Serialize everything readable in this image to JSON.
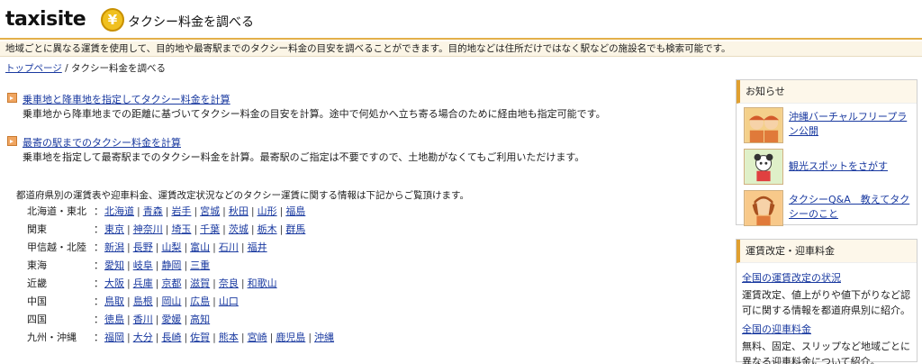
{
  "header": {
    "logo_text": "taxisite",
    "logo_yen": "¥",
    "title": "タクシー料金を調べる"
  },
  "intro": "地域ごとに異なる運賃を使用して、目的地や最寄駅までのタクシー料金の目安を調べることができます。目的地などは住所だけではなく駅などの施設名でも検索可能です。",
  "breadcrumb": {
    "home": "トップページ",
    "separator": "/",
    "current": "タクシー料金を調べる"
  },
  "menu": [
    {
      "link": "乗車地と降車地を指定してタクシー料金を計算",
      "desc": "乗車地から降車地までの距離に基づいてタクシー料金の目安を計算。途中で何処かへ立ち寄る場合のために経由地も指定可能です。"
    },
    {
      "link": "最寄の駅までのタクシー料金を計算",
      "desc": "乗車地を指定して最寄駅までのタクシー料金を計算。最寄駅のご指定は不要ですので、土地勘がなくてもご利用いただけます。"
    }
  ],
  "region_intro": "都道府県別の運賃表や迎車料金、運賃改定状況などのタクシー運賃に関する情報は下記からご覧頂けます。",
  "regions": [
    {
      "name": "北海道・東北",
      "prefs": [
        "北海道",
        "青森",
        "岩手",
        "宮城",
        "秋田",
        "山形",
        "福島"
      ]
    },
    {
      "name": "関東",
      "prefs": [
        "東京",
        "神奈川",
        "埼玉",
        "千葉",
        "茨城",
        "栃木",
        "群馬"
      ]
    },
    {
      "name": "甲信越・北陸",
      "prefs": [
        "新潟",
        "長野",
        "山梨",
        "富山",
        "石川",
        "福井"
      ]
    },
    {
      "name": "東海",
      "prefs": [
        "愛知",
        "岐阜",
        "静岡",
        "三重"
      ]
    },
    {
      "name": "近畿",
      "prefs": [
        "大阪",
        "兵庫",
        "京都",
        "滋賀",
        "奈良",
        "和歌山"
      ]
    },
    {
      "name": "中国",
      "prefs": [
        "鳥取",
        "島根",
        "岡山",
        "広島",
        "山口"
      ]
    },
    {
      "name": "四国",
      "prefs": [
        "徳島",
        "香川",
        "愛媛",
        "高知"
      ]
    },
    {
      "name": "九州・沖縄",
      "prefs": [
        "福岡",
        "大分",
        "長崎",
        "佐賀",
        "熊本",
        "宮崎",
        "鹿児島",
        "沖縄"
      ]
    }
  ],
  "region_colon": "：",
  "pref_separator": "|",
  "sidebar": {
    "news_title": "お知らせ",
    "news": [
      {
        "label": "沖縄バーチャルフリープラン公開",
        "icon": "taxi-drivers-icon"
      },
      {
        "label": "観光スポットをさがす",
        "icon": "sightseeing-character-icon"
      },
      {
        "label": "タクシーQ&A　教えてタクシーのこと",
        "icon": "girl-character-icon"
      }
    ],
    "fare_title": "運賃改定・迎車料金",
    "fare_links": [
      {
        "link": "全国の運賃改定の状況",
        "desc": "運賃改定、値上がりや値下がりなど認可に関する情報を都道府県別に紹介。"
      },
      {
        "link": "全国の迎車料金",
        "desc": "無料、固定、スリップなど地域ごとに異なる迎車料金について紹介。"
      }
    ]
  },
  "colors": {
    "accent": "#e3b04a",
    "link": "#1a3aa0",
    "menu_icon": "#f0a560"
  }
}
